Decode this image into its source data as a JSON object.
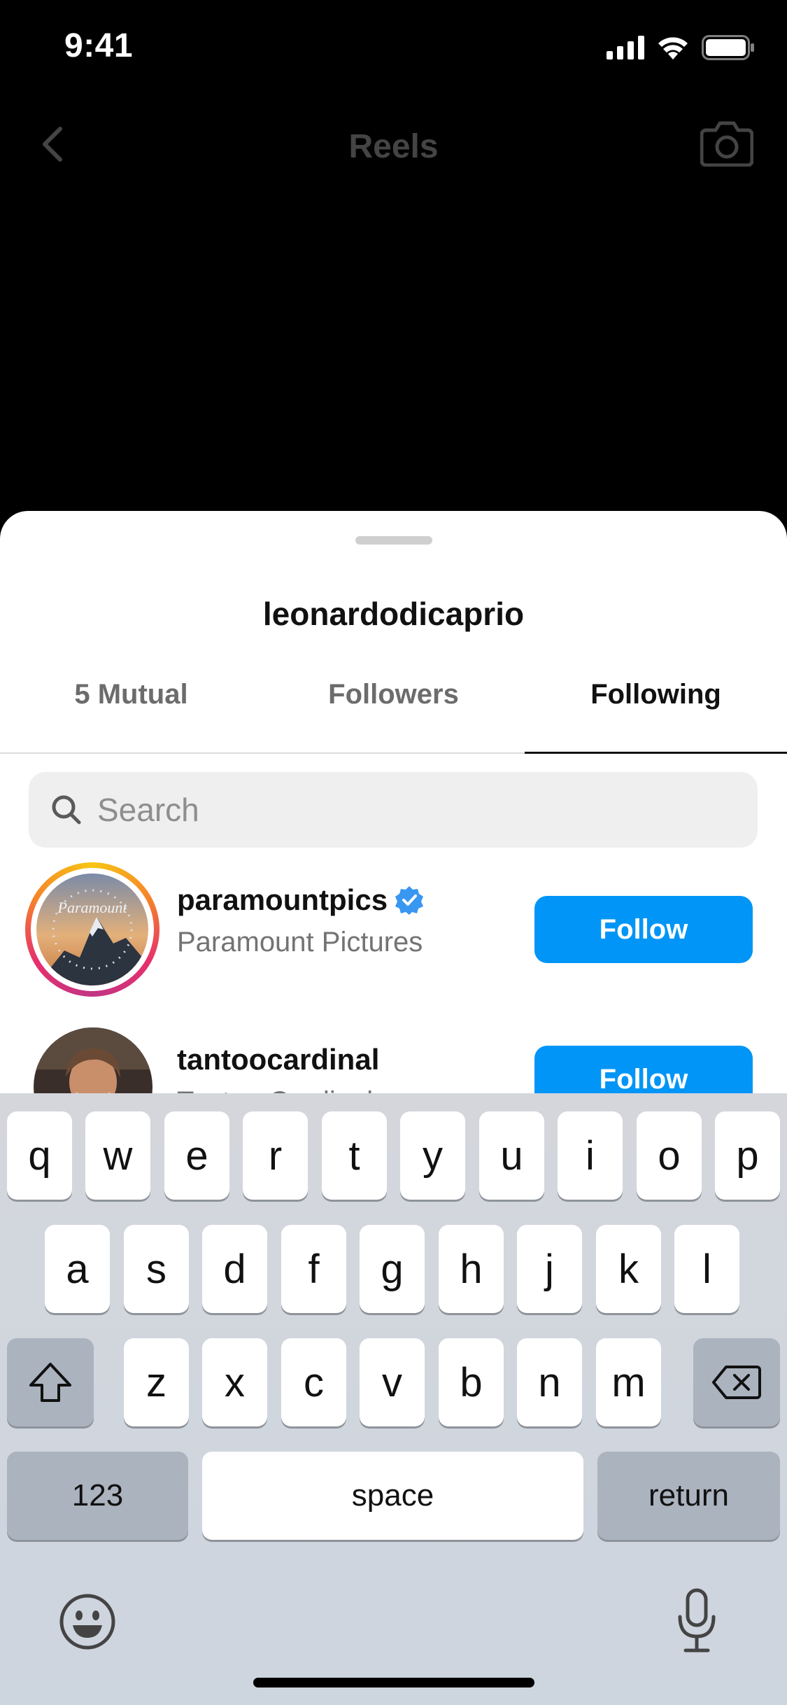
{
  "status_bar": {
    "time": "9:41"
  },
  "nav": {
    "title": "Reels"
  },
  "sheet": {
    "username": "leonardodicaprio",
    "tabs": [
      {
        "label": "5 Mutual",
        "active": false
      },
      {
        "label": "Followers",
        "active": false
      },
      {
        "label": "Following",
        "active": true
      }
    ],
    "search": {
      "placeholder": "Search",
      "value": ""
    },
    "accounts": [
      {
        "username": "paramountpics",
        "full_name": "Paramount Pictures",
        "verified": true,
        "has_story_ring": true,
        "button": "Follow"
      },
      {
        "username": "tantoocardinal",
        "full_name": "Tantoo Cardinal",
        "verified": false,
        "has_story_ring": false,
        "button": "Follow"
      }
    ]
  },
  "keyboard": {
    "row1": [
      "q",
      "w",
      "e",
      "r",
      "t",
      "y",
      "u",
      "i",
      "o",
      "p"
    ],
    "row2": [
      "a",
      "s",
      "d",
      "f",
      "g",
      "h",
      "j",
      "k",
      "l"
    ],
    "row3": [
      "z",
      "x",
      "c",
      "v",
      "b",
      "n",
      "m"
    ],
    "numbers_label": "123",
    "space_label": "space",
    "return_label": "return"
  },
  "colors": {
    "follow_button": "#0095f6",
    "verified": "#3897f0"
  }
}
